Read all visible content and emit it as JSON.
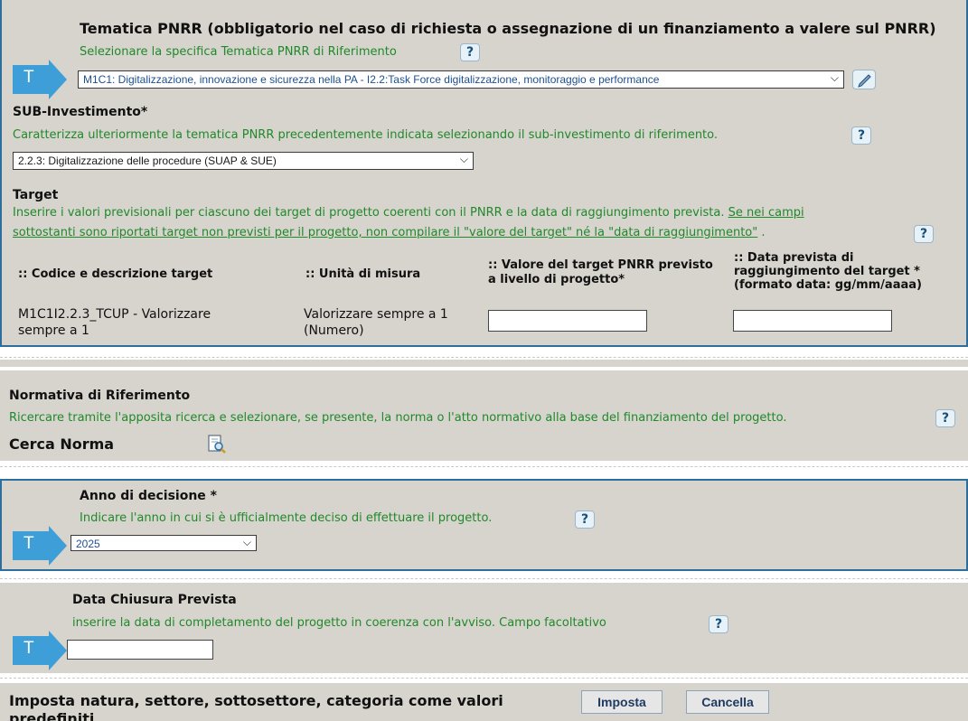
{
  "tematica": {
    "title": "Tematica PNRR (obbligatorio nel caso di richiesta o assegnazione di un finanziamento a valere sul PNRR)",
    "hint": "Selezionare la specifica Tematica PNRR di Riferimento",
    "selected": "M1C1: Digitalizzazione, innovazione e sicurezza nella PA - I2.2:Task Force digitalizzazione, monitoraggio e performance",
    "arrow_letter": "T"
  },
  "sub_investimento": {
    "title": "SUB-Investimento*",
    "hint": "Caratterizza ulteriormente la tematica PNRR precedentemente indicata selezionando il sub-investimento di riferimento.",
    "selected": "2.2.3: Digitalizzazione delle procedure (SUAP & SUE)"
  },
  "target": {
    "title": "Target",
    "hint_1": "Inserire i valori previsionali per ciascuno dei target di progetto coerenti con il PNRR e la data di raggiungimento prevista.",
    "hint_1_link": "Se nei campi",
    "hint_2": "sottostanti sono riportati target non previsti per il progetto, non compilare il \"valore del target\" né la \"data di raggiungimento\"",
    "hint_2_end": " .",
    "columns": [
      ":: Codice e descrizione target",
      ":: Unità di misura",
      ":: Valore del target PNRR previsto a livello di progetto*",
      ":: Data prevista di raggiungimento del target * (formato data: gg/mm/aaaa)"
    ],
    "rows": [
      {
        "code_line1": "M1C1I2.2.3_TCUP - Valorizzare",
        "code_line2": "sempre a 1",
        "unit_line1": "Valorizzare sempre a 1",
        "unit_line2": "(Numero)",
        "value": "",
        "date": ""
      }
    ]
  },
  "normativa": {
    "title": "Normativa di Riferimento",
    "hint": "Ricercare tramite l'apposita ricerca e selezionare, se presente, la norma o l'atto normativo alla base del finanziamento del progetto.",
    "search_label": "Cerca Norma"
  },
  "anno": {
    "title": "Anno di decisione *",
    "hint": "Indicare l'anno in cui si è ufficialmente deciso di effettuare il progetto.",
    "selected": "2025",
    "arrow_letter": "T"
  },
  "chiusura": {
    "title": "Data Chiusura Prevista",
    "hint": "inserire la data di completamento del progetto in coerenza con l'avviso. Campo facoltativo",
    "value": "",
    "arrow_letter": "T"
  },
  "imposta": {
    "label_line1": "Imposta natura, settore, sottosettore, categoria come valori",
    "label_line2": "predefiniti",
    "imposta_button": "Imposta",
    "cancella_button": "Cancella"
  },
  "help_glyph": "?",
  "colors": {
    "hint_green": "#1f8a2a",
    "arrow_blue": "#3e9fd8",
    "panel_bg": "#d7d3cd",
    "border_blue": "#2c6f9e"
  }
}
